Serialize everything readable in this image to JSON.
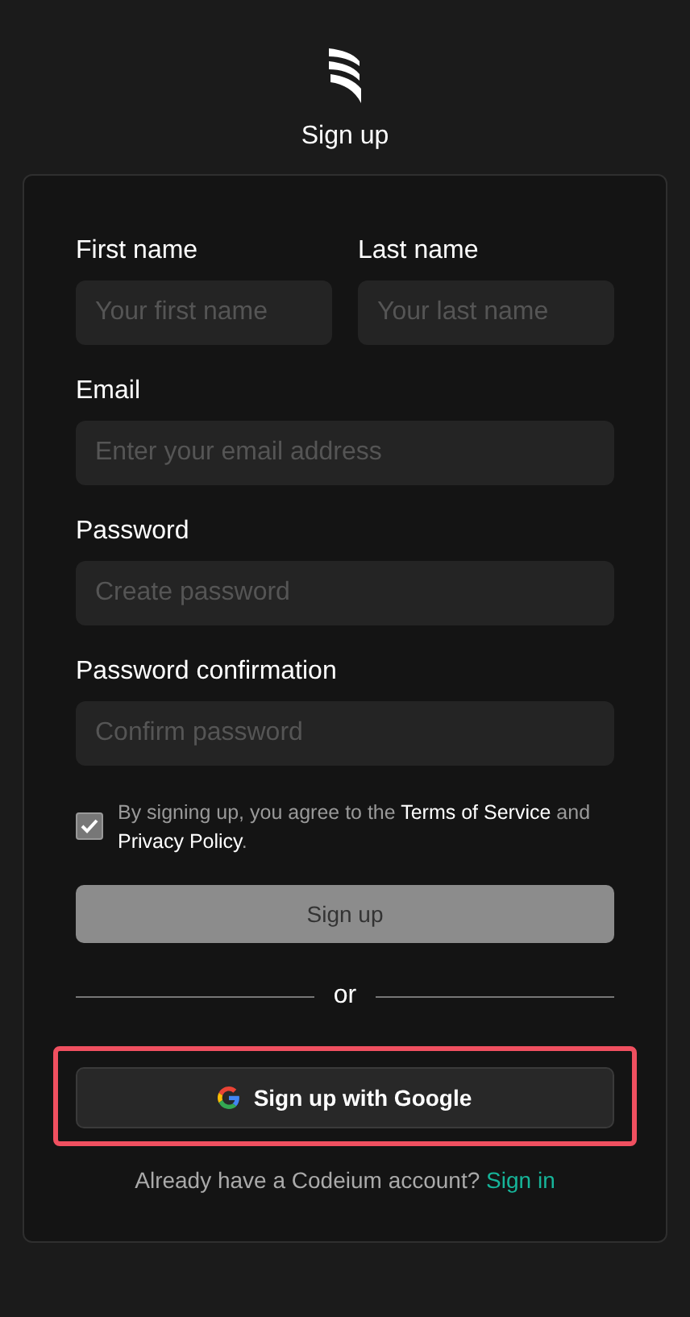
{
  "header": {
    "title": "Sign up"
  },
  "form": {
    "name_fields": [
      {
        "label": "First name",
        "placeholder": "Your first name"
      },
      {
        "label": "Last name",
        "placeholder": "Your last name"
      }
    ],
    "fields": [
      {
        "label": "Email",
        "placeholder": "Enter your email address"
      },
      {
        "label": "Password",
        "placeholder": "Create password"
      },
      {
        "label": "Password confirmation",
        "placeholder": "Confirm password"
      }
    ],
    "agreement": {
      "checked": true,
      "before": "By signing up, you agree to the",
      "terms_link": "Terms of Service",
      "middle": "and",
      "privacy_link": "Privacy Policy",
      "after": "."
    },
    "submit_button": {
      "label": "Sign up",
      "disabled": true
    },
    "divider_text": "or",
    "google_button": {
      "label": "Sign up with Google",
      "highlighted": true
    },
    "footer": {
      "text": "Already have a Codeium account?",
      "link": "Sign in"
    }
  }
}
